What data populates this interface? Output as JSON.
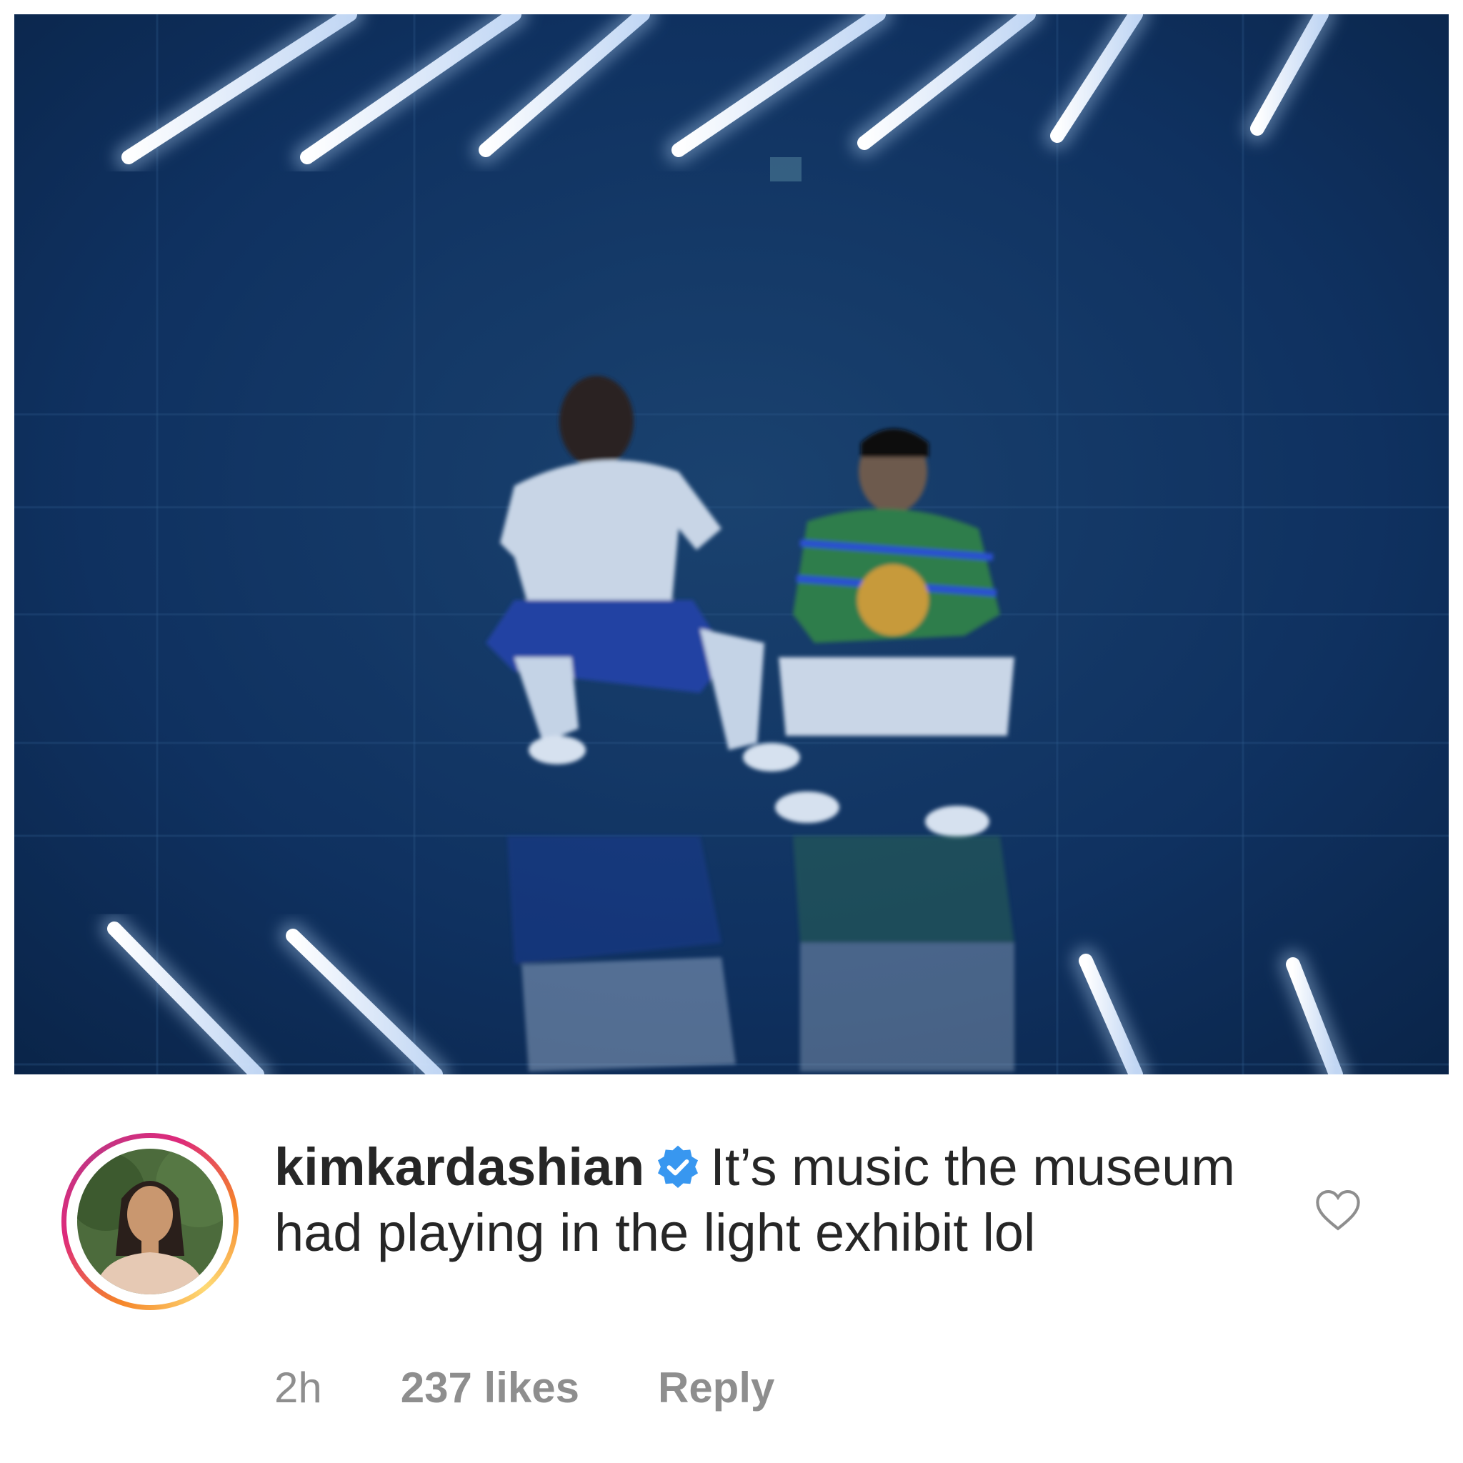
{
  "post": {
    "image_alt": "Two men crouching in a dark blue room with angled light tubes reflected in a mirrored floor"
  },
  "comment": {
    "username": "kimkardashian",
    "verified": true,
    "text": "It’s music the museum had playing in the light exhibit lol",
    "time": "2h",
    "likes": "237 likes",
    "reply_label": "Reply"
  },
  "icons": {
    "verified": "verified-badge-icon",
    "like": "heart-outline-icon",
    "avatar": "profile-avatar"
  },
  "colors": {
    "text": "#262626",
    "meta": "#8e8e8e",
    "verified": "#3897f0",
    "photo_bg": "#0c2a52"
  }
}
